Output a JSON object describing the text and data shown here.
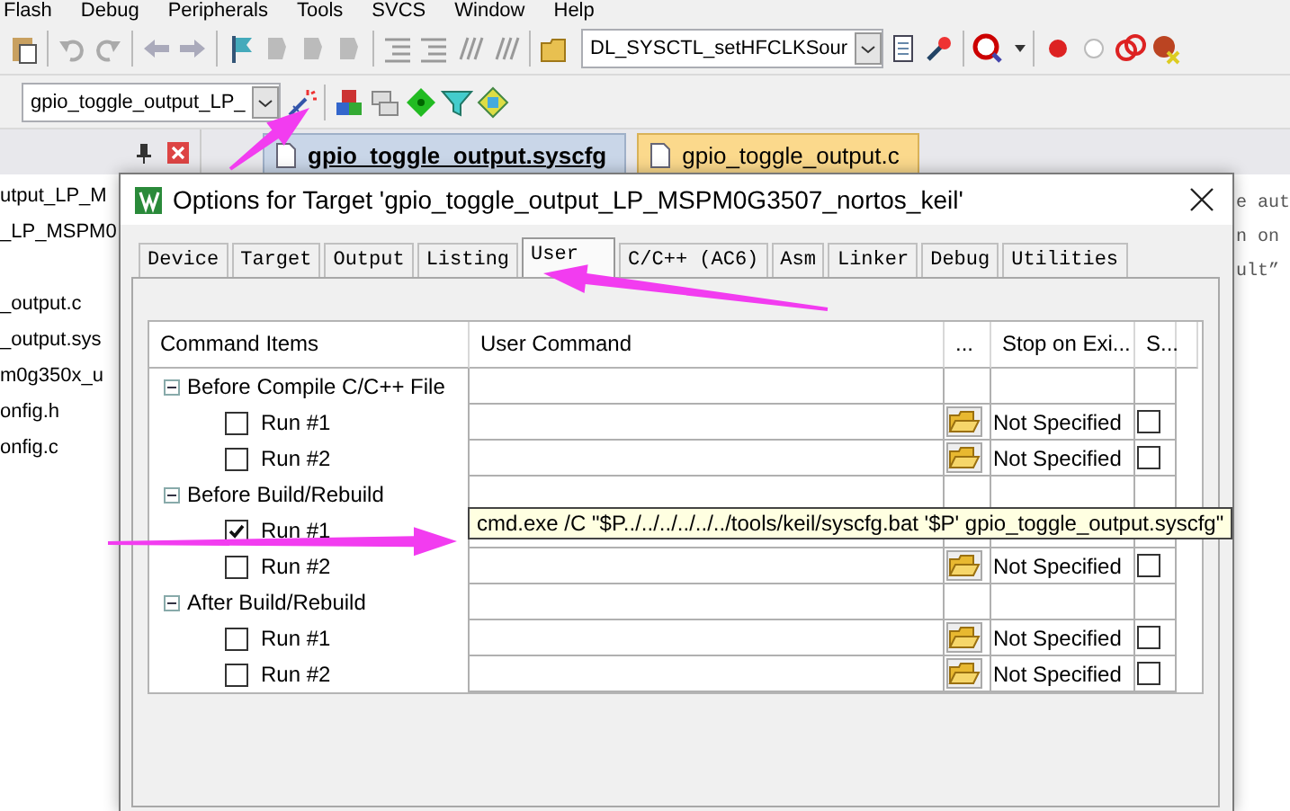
{
  "menu_bar": [
    "Flash",
    "Debug",
    "Peripherals",
    "Tools",
    "SVCS",
    "Window",
    "Help"
  ],
  "toolbar_1": {
    "function_select": "DL_SYSCTL_setHFCLKSour"
  },
  "toolbar_2": {
    "target_select": "gpio_toggle_output_LP_"
  },
  "editor_tabs": [
    {
      "label": "gpio_toggle_output.syscfg",
      "selected": true
    },
    {
      "label": "gpio_toggle_output.c",
      "selected": false
    }
  ],
  "project_tree": [
    {
      "items": [
        "utput_LP_M",
        "_LP_MSPM0"
      ]
    },
    {
      "items": [
        "_output.c",
        "_output.sys",
        "m0g350x_u",
        "onfig.h",
        "onfig.c"
      ]
    }
  ],
  "editor_lines": [
    "e aut",
    "n on",
    "ult”"
  ],
  "dialog": {
    "title": "Options for Target 'gpio_toggle_output_LP_MSPM0G3507_nortos_keil'",
    "tabs": [
      {
        "label": "Device",
        "selected": false
      },
      {
        "label": "Target",
        "selected": false
      },
      {
        "label": "Output",
        "selected": false
      },
      {
        "label": "Listing",
        "selected": false
      },
      {
        "label": "User",
        "selected": true
      },
      {
        "label": "C/C++ (AC6)",
        "selected": false
      },
      {
        "label": "Asm",
        "selected": false
      },
      {
        "label": "Linker",
        "selected": false
      },
      {
        "label": "Debug",
        "selected": false
      },
      {
        "label": "Utilities",
        "selected": false
      }
    ],
    "columns": [
      "Command Items",
      "User Command",
      "...",
      "Stop on Exi...",
      "S..."
    ],
    "command_items": [
      {
        "label": "Before Compile C/C++ File",
        "expanded": true,
        "children": [
          {
            "label": "Run #1",
            "checked": false,
            "stop_on_exit": "Not Specified",
            "column_5_checked": false
          },
          {
            "label": "Run #2",
            "checked": false,
            "stop_on_exit": "Not Specified",
            "column_5_checked": false
          }
        ]
      },
      {
        "label": "Before Build/Rebuild",
        "expanded": true,
        "children": [
          {
            "label": "Run #1",
            "checked": true
          },
          {
            "label": "Run #2",
            "checked": false,
            "stop_on_exit": "Not Specified",
            "column_5_checked": false
          }
        ]
      },
      {
        "label": "After Build/Rebuild",
        "expanded": true,
        "children": [
          {
            "label": "Run #1",
            "checked": false,
            "stop_on_exit": "Not Specified",
            "column_5_checked": false
          },
          {
            "label": "Run #2",
            "checked": false,
            "stop_on_exit": "Not Specified",
            "column_5_checked": false
          }
        ]
      }
    ],
    "tooltip": "cmd.exe /C \"$P../../../../../../tools/keil/syscfg.bat '$P' gpio_toggle_output.syscfg\""
  }
}
